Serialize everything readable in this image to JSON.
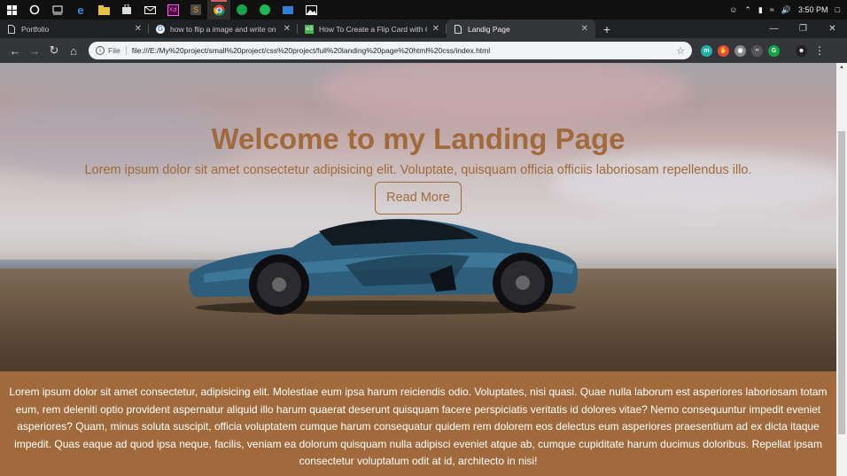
{
  "taskbar": {
    "icons": [
      "windows-start-icon",
      "cortana-icon",
      "task-view-icon",
      "edge-icon",
      "file-explorer-icon",
      "store-icon",
      "mail-icon",
      "xd-icon",
      "sublime-icon",
      "chrome-icon",
      "gmail-icon",
      "spotify-icon",
      "photos-icon",
      "image-viewer-icon"
    ],
    "clock": "3:50 PM"
  },
  "tabs": [
    {
      "title": "Portfolio",
      "icon": "page-icon",
      "active": false
    },
    {
      "title": "how to flip a image and write on",
      "icon": "google-icon",
      "active": false
    },
    {
      "title": "How To Create a Flip Card with C",
      "icon": "w3schools-icon",
      "active": false
    },
    {
      "title": "Landig Page",
      "icon": "page-icon",
      "active": true
    }
  ],
  "toolbar": {
    "scheme": "File",
    "url": "file:///E:/My%20project/small%20project/css%20project/full%20landing%20page%20html%20css/index.html"
  },
  "extensions": [
    {
      "name": "momentum-icon",
      "color": "#1fb0a8",
      "glyph": "m"
    },
    {
      "name": "adblock-icon",
      "color": "#e34a3a",
      "glyph": "✋"
    },
    {
      "name": "camera-icon",
      "color": "#888888",
      "glyph": "◉"
    },
    {
      "name": "ext-icon",
      "color": "#555555",
      "glyph": "‹›"
    },
    {
      "name": "grammarly-icon",
      "color": "#16a34a",
      "glyph": "G"
    },
    {
      "name": "profile-icon",
      "color": "#222222",
      "glyph": "☻"
    }
  ],
  "hero": {
    "title": "Welcome to my Landing Page",
    "subtitle": "Lorem ipsum dolor sit amet consectetur adipisicing elit. Voluptate, quisquam officia officiis laboriosam repellendus illo.",
    "button": "Read More"
  },
  "body_text": "Lorem ipsum dolor sit amet consectetur, adipisicing elit. Molestiae eum ipsa harum reiciendis odio. Voluptates, nisi quasi. Quae nulla laborum est asperiores laboriosam totam eum, rem deleniti optio provident aspernatur aliquid illo harum quaerat deserunt quisquam facere perspiciatis veritatis id dolores vitae? Nemo consequuntur impedit eveniet asperiores? Quam, minus soluta suscipit, officia voluptatem cumque harum consequatur quidem rem dolorem eos delectus eum asperiores praesentium ad ex dicta itaque impedit. Quas eaque ad quod ipsa neque, facilis, veniam ea dolorum quisquam nulla adipisci eveniet atque ab, cumque cupiditate harum ducimus doloribus. Repellat ipsam consectetur voluptatum odit at id, architecto in nisi!",
  "colors": {
    "accent": "#a06a3c",
    "tab_bg": "#202124",
    "toolbar_bg": "#35363a"
  }
}
